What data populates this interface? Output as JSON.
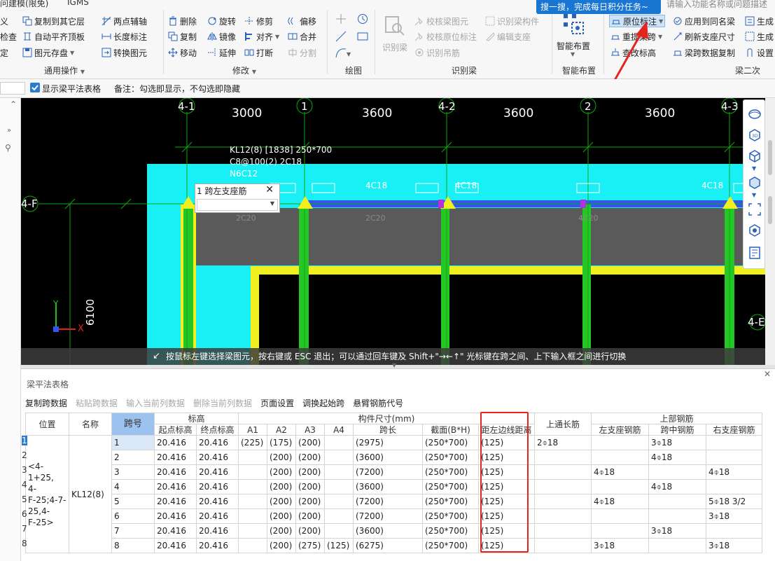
{
  "top_partial": {
    "left_title": "问建模(限免)",
    "igms": "IGMS"
  },
  "tooltip": "搜一搜，完成每日积分任务~",
  "search": {
    "placeholder": "请输入功能名称或问题描述"
  },
  "ribbon": {
    "left_cut": [
      "义",
      "检查",
      "定"
    ],
    "general": {
      "items": [
        "复制到其它层",
        "两点辅轴",
        "自动平齐顶板",
        "长度标注",
        "图元存盘",
        "转换图元"
      ],
      "label": "通用操作"
    },
    "modify": {
      "items": [
        "删除",
        "旋转",
        "修剪",
        "偏移",
        "复制",
        "镜像",
        "对齐",
        "合并",
        "移动",
        "延伸",
        "打断",
        "分割"
      ],
      "label": "修改"
    },
    "draw": {
      "label": "绘图"
    },
    "identify": {
      "items": [
        "识别梁",
        "校核梁图元",
        "识别梁构件",
        "校核原位标注",
        "编辑支座",
        "识别吊筋"
      ],
      "label": "识别梁"
    },
    "smart": {
      "big_label": "智能布置",
      "label": "智能布置"
    },
    "beam2": {
      "items": [
        "原位标注",
        "应用到同名梁",
        "生成",
        "重提梁跨",
        "刷新支座尺寸",
        "生成",
        "查改标高",
        "梁跨数据复制",
        "设置"
      ],
      "label": "梁二次"
    }
  },
  "subbar": {
    "checkbox_checked": true,
    "checkbox_label": "显示梁平法表格",
    "note": "备注：勾选即显示，不勾选即隐藏"
  },
  "canvas": {
    "axes_top": [
      "4-1",
      "1",
      "4-2",
      "2",
      "4-3"
    ],
    "spans_top": [
      "3000",
      "3600",
      "3600",
      "3600"
    ],
    "axis_left": "4-F",
    "axis_right": "4-E",
    "dim_left": "6100",
    "ucs": {
      "y": "Y",
      "x": "X"
    },
    "beam_annotation": [
      "KL12(8) [1838] 250*700",
      "C8@100(2) 2C18",
      "N6C12"
    ],
    "top_rebar_labels": [
      "4C18",
      "4C18",
      "4C18"
    ],
    "bottom_rebar_labels": [
      "2C20",
      "2C20",
      "4C20"
    ],
    "popup": {
      "title": "1 跨左支座筋",
      "value": ""
    },
    "status": "按鼠标左键选择梁图元，按右键或 ESC 退出；可以通过回车键及 Shift+\"→←↑\" 光标键在跨之间、上下输入框之间进行切换"
  },
  "table_panel": {
    "title": "梁平法表格",
    "toolbar": [
      {
        "label": "复制跨数据",
        "enabled": true
      },
      {
        "label": "粘贴跨数据",
        "enabled": false
      },
      {
        "label": "输入当前列数据",
        "enabled": false
      },
      {
        "label": "删除当前列数据",
        "enabled": false
      },
      {
        "label": "页面设置",
        "enabled": true
      },
      {
        "label": "调换起始跨",
        "enabled": true
      },
      {
        "label": "悬臂钢筋代号",
        "enabled": true
      }
    ],
    "headers": {
      "position": "位置",
      "name": "名称",
      "span_no": "跨号",
      "elevation": "标高",
      "start_elev": "起点标高",
      "end_elev": "终点标高",
      "member_size": "构件尺寸(mm)",
      "a1": "A1",
      "a2": "A2",
      "a3": "A3",
      "a4": "A4",
      "span_len": "跨长",
      "section": "截面(B*H)",
      "edge_dist": "距左边线距离",
      "top_through": "上通长筋",
      "top_rebar": "上部钢筋",
      "left_support": "左支座钢筋",
      "mid_span": "跨中钢筋",
      "right_support": "右支座钢筋"
    },
    "position_value": "<4-1+25,\n4-\nF-25;4-7-\n25,4-\nF-25>",
    "name_value": "KL12(8)",
    "row_numbers": [
      "1",
      "2",
      "3",
      "4",
      "5",
      "6",
      "7",
      "8"
    ],
    "rows": [
      {
        "span": "1",
        "start": "20.416",
        "end": "20.416",
        "a1": "(225)",
        "a2": "(175)",
        "a3": "(200)",
        "a4": "",
        "len": "(2975)",
        "sec": "(250*700)",
        "edge": "(125)",
        "through": "2⌽18",
        "left": "",
        "mid": "3⌽18",
        "right": ""
      },
      {
        "span": "2",
        "start": "20.416",
        "end": "20.416",
        "a1": "",
        "a2": "(200)",
        "a3": "(200)",
        "a4": "",
        "len": "(3600)",
        "sec": "(250*700)",
        "edge": "(125)",
        "through": "",
        "left": "",
        "mid": "4⌽18",
        "right": ""
      },
      {
        "span": "3",
        "start": "20.416",
        "end": "20.416",
        "a1": "",
        "a2": "(200)",
        "a3": "(200)",
        "a4": "",
        "len": "(7200)",
        "sec": "(250*700)",
        "edge": "(125)",
        "through": "",
        "left": "4⌽18",
        "mid": "",
        "right": "4⌽18"
      },
      {
        "span": "4",
        "start": "20.416",
        "end": "20.416",
        "a1": "",
        "a2": "(200)",
        "a3": "(200)",
        "a4": "",
        "len": "(3600)",
        "sec": "(250*700)",
        "edge": "(125)",
        "through": "",
        "left": "",
        "mid": "4⌽18",
        "right": ""
      },
      {
        "span": "5",
        "start": "20.416",
        "end": "20.416",
        "a1": "",
        "a2": "(200)",
        "a3": "(200)",
        "a4": "",
        "len": "(7200)",
        "sec": "(250*700)",
        "edge": "(125)",
        "through": "",
        "left": "4⌽18",
        "mid": "",
        "right": "5⌽18 3/2"
      },
      {
        "span": "6",
        "start": "20.416",
        "end": "20.416",
        "a1": "",
        "a2": "(200)",
        "a3": "(200)",
        "a4": "",
        "len": "(7200)",
        "sec": "(250*700)",
        "edge": "(125)",
        "through": "",
        "left": "",
        "mid": "",
        "right": "3⌽18"
      },
      {
        "span": "7",
        "start": "20.416",
        "end": "20.416",
        "a1": "",
        "a2": "(200)",
        "a3": "(200)",
        "a4": "",
        "len": "(3600)",
        "sec": "(250*700)",
        "edge": "(125)",
        "through": "",
        "left": "",
        "mid": "3⌽18",
        "right": ""
      },
      {
        "span": "8",
        "start": "20.416",
        "end": "20.416",
        "a1": "",
        "a2": "(200)",
        "a3": "(275)",
        "a4": "(125)",
        "len": "(6275)",
        "sec": "(250*700)",
        "edge": "(125)",
        "through": "",
        "left": "3⌽18",
        "mid": "",
        "right": "3⌽18"
      }
    ]
  },
  "colors": {
    "canvas_bg": "#000000",
    "cyan_slab": "#19f0f5",
    "wall_yellow": "#f0f020",
    "column_green": "#25c725",
    "axis_green": "#12a612",
    "beam_blue": "#3355ee",
    "highlight_red": "#e0261e",
    "tooltip_blue": "#1976d2"
  }
}
